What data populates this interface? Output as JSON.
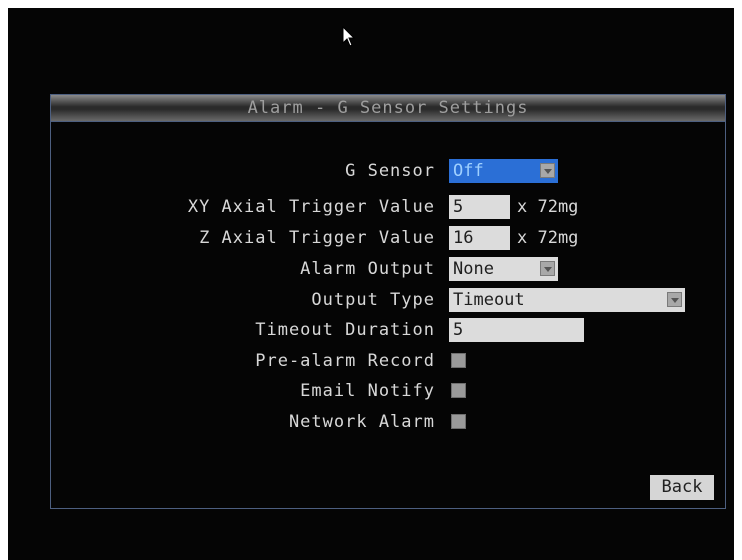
{
  "dialog": {
    "title": "Alarm - G Sensor Settings",
    "fields": {
      "g_sensor": {
        "label": "G Sensor",
        "value": "Off"
      },
      "xy_trigger": {
        "label": "XY Axial Trigger Value",
        "value": "5",
        "unit": "x 72mg"
      },
      "z_trigger": {
        "label": "Z Axial Trigger Value",
        "value": "16",
        "unit": "x 72mg"
      },
      "alarm_output": {
        "label": "Alarm Output",
        "value": "None"
      },
      "output_type": {
        "label": "Output Type",
        "value": "Timeout"
      },
      "timeout_duration": {
        "label": "Timeout Duration",
        "value": "5"
      },
      "pre_alarm_record": {
        "label": "Pre-alarm Record",
        "checked": false
      },
      "email_notify": {
        "label": "Email Notify",
        "checked": false
      },
      "network_alarm": {
        "label": "Network Alarm",
        "checked": false
      }
    },
    "back_label": "Back"
  },
  "icons": {
    "cursor": "mouse-pointer-icon",
    "dropdown": "chevron-down-icon"
  },
  "colors": {
    "selected_field": "#2b6fd6",
    "screen_bg": "#050505",
    "border": "#4d5f80"
  }
}
